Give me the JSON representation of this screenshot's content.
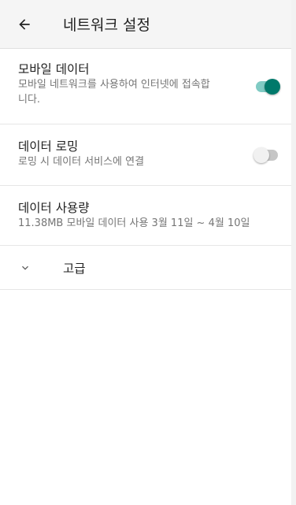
{
  "appbar": {
    "title": "네트워크 설정",
    "back_icon": "arrow-back-icon"
  },
  "preferences": [
    {
      "title": "모바일 데이터",
      "summary_line1": "모바일 네트워크를 사용하여 인터넷에 접속합",
      "summary_line2": "니다.",
      "switch": {
        "on": true
      }
    },
    {
      "title": "데이터 로밍",
      "summary": "로밍 시 데이터 서비스에 연결",
      "switch": {
        "on": false
      }
    },
    {
      "title": "데이터 사용량",
      "summary": "11.38MB 모바일 데이터 사용 3월 11일 ~ 4월 10일"
    }
  ],
  "advanced": {
    "label": "고급",
    "icon": "chevron-down-icon"
  },
  "colors": {
    "accent": "#00796b",
    "accent_track": "#80cbc4",
    "switch_off_track": "#c6c6c6",
    "switch_off_thumb": "#f1f1f1"
  }
}
